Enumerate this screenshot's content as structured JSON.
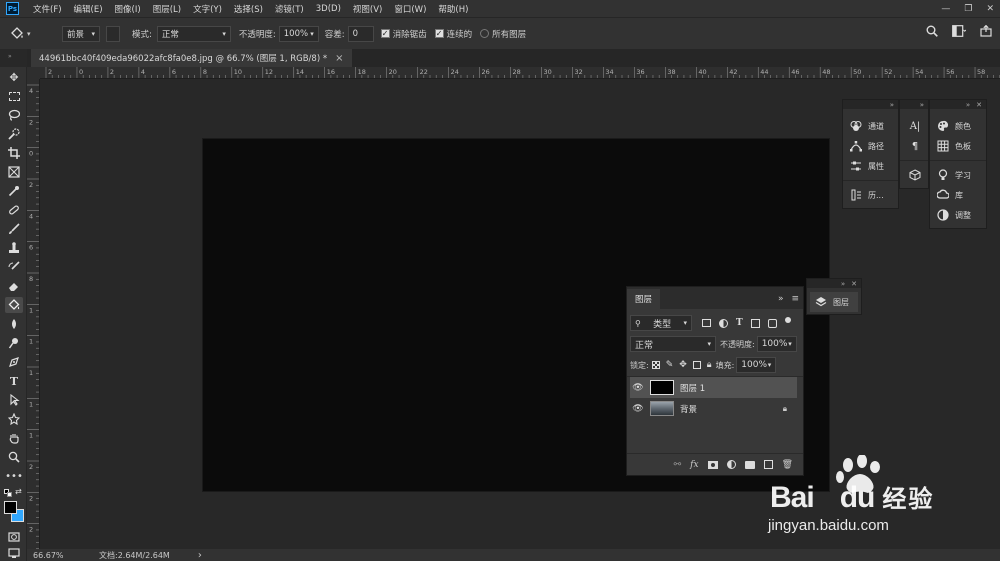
{
  "menubar": {
    "logo": "Ps",
    "items": [
      "文件(F)",
      "编辑(E)",
      "图像(I)",
      "图层(L)",
      "文字(Y)",
      "选择(S)",
      "滤镜(T)",
      "3D(D)",
      "视图(V)",
      "窗口(W)",
      "帮助(H)"
    ],
    "window_controls": [
      "—",
      "❐",
      "✕"
    ]
  },
  "options": {
    "fill_source": "前景",
    "mode_label": "模式:",
    "mode_value": "正常",
    "opacity_label": "不透明度:",
    "opacity_value": "100%",
    "tolerance_label": "容差:",
    "tolerance_value": "0",
    "antialias_label": "消除锯齿",
    "contiguous_label": "连续的",
    "all_layers_label": "所有图层"
  },
  "document_tab": {
    "title": "44961bbc40f409eda96022afc8fa0e8.jpg @ 66.7% (图层 1, RGB/8) *",
    "close": "×"
  },
  "ruler": {
    "h_labels": [
      "2",
      "0",
      "2",
      "4",
      "6",
      "8",
      "10",
      "12",
      "14",
      "16",
      "18",
      "20",
      "22",
      "24",
      "26",
      "28",
      "30",
      "32",
      "34",
      "36",
      "38",
      "40",
      "42",
      "44",
      "46",
      "48",
      "50",
      "52",
      "54",
      "56",
      "58"
    ],
    "v_labels": [
      "4",
      "2",
      "0",
      "2",
      "4",
      "6",
      "8",
      "1",
      "1",
      "1",
      "1",
      "1",
      "2",
      "2",
      "2"
    ]
  },
  "status": {
    "zoom": "66.67%",
    "doc_info": "文档:2.64M/2.64M",
    "arrow": "›"
  },
  "dock": {
    "col1": [
      "通道",
      "路径",
      "属性",
      "历..."
    ],
    "col3": [
      "颜色",
      "色板",
      "学习",
      "库",
      "调整"
    ],
    "layers_mini": "图层"
  },
  "layers_panel": {
    "tab": "图层",
    "filter_label": "类型",
    "blend_mode": "正常",
    "opacity_label": "不透明度:",
    "opacity_value": "100%",
    "lock_label": "锁定:",
    "fill_label": "填充:",
    "fill_value": "100%",
    "layers": [
      {
        "name": "图层 1",
        "selected": true
      },
      {
        "name": "背景",
        "selected": false
      }
    ]
  },
  "watermark": {
    "brand": "Bai",
    "brand2": "du",
    "cn": "经验",
    "url": "jingyan.baidu.com"
  },
  "colors": {
    "canvas": "#0b0b0b",
    "panel": "#323232",
    "accent": "#31a8ff"
  }
}
